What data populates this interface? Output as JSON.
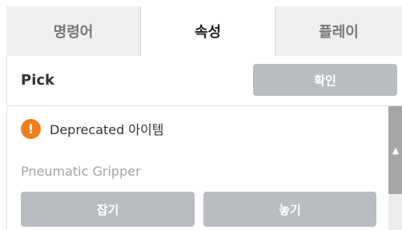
{
  "tabs": [
    {
      "label": "명령어",
      "active": false
    },
    {
      "label": "속성",
      "active": true
    },
    {
      "label": "플레이",
      "active": false
    }
  ],
  "header": {
    "title": "Pick",
    "confirm_label": "확인"
  },
  "warning": {
    "icon": "exclamation-circle-icon",
    "icon_glyph": "!",
    "icon_color": "#f07d1e",
    "text": "Deprecated 아이템"
  },
  "gripper": {
    "label": "Pneumatic Gripper",
    "grip_label": "잡기",
    "release_label": "놓기"
  },
  "scrollbar": {
    "arrow_glyph": "▲"
  },
  "colors": {
    "button_bg": "#b9bdc2",
    "tab_inactive_bg": "#efefef",
    "accent_warning": "#f07d1e"
  }
}
